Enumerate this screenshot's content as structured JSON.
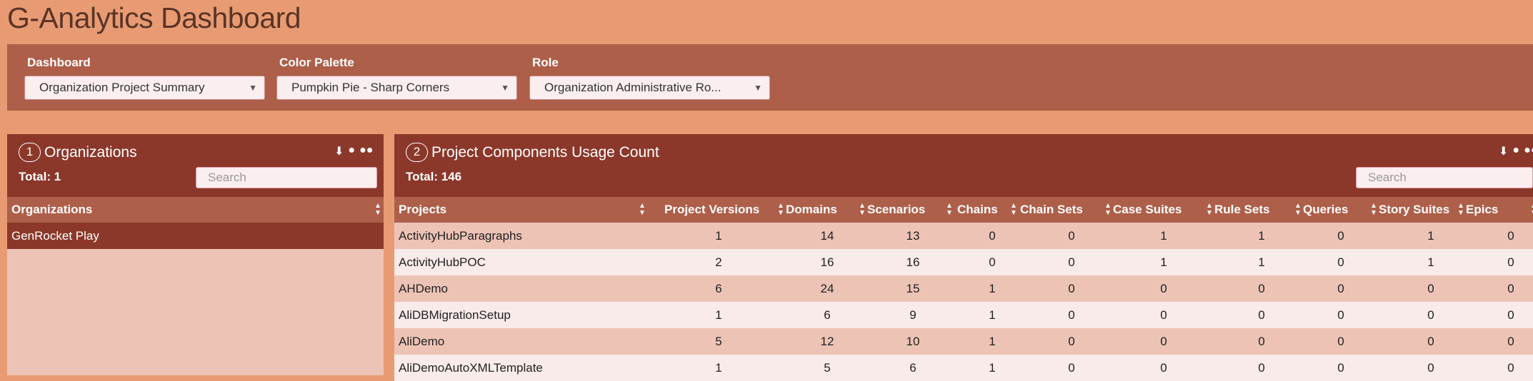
{
  "page": {
    "title": "G-Analytics Dashboard"
  },
  "filters": {
    "dashboard": {
      "label": "Dashboard",
      "value": "Organization Project Summary"
    },
    "palette": {
      "label": "Color Palette",
      "value": "Pumpkin Pie - Sharp Corners"
    },
    "role": {
      "label": "Role",
      "value": "Organization Administrative Ro..."
    }
  },
  "orgs": {
    "number": "1",
    "title": "Organizations",
    "total": "Total: 1",
    "search_placeholder": "Search",
    "column": "Organizations",
    "rows": [
      "GenRocket Play"
    ]
  },
  "components": {
    "number": "2",
    "title": "Project Components Usage Count",
    "total": "Total: 146",
    "search_placeholder": "Search",
    "columns": [
      "Projects",
      "Project Versions",
      "Domains",
      "Scenarios",
      "Chains",
      "Chain Sets",
      "Case Suites",
      "Rule Sets",
      "Queries",
      "Story Suites",
      "Epics"
    ],
    "rows": [
      [
        "ActivityHubParagraphs",
        "1",
        "14",
        "13",
        "0",
        "0",
        "1",
        "1",
        "0",
        "1",
        "0"
      ],
      [
        "ActivityHubPOC",
        "2",
        "16",
        "16",
        "0",
        "0",
        "1",
        "1",
        "0",
        "1",
        "0"
      ],
      [
        "AHDemo",
        "6",
        "24",
        "15",
        "1",
        "0",
        "0",
        "0",
        "0",
        "0",
        "0"
      ],
      [
        "AliDBMigrationSetup",
        "1",
        "6",
        "9",
        "1",
        "0",
        "0",
        "0",
        "0",
        "0",
        "0"
      ],
      [
        "AliDemo",
        "5",
        "12",
        "10",
        "1",
        "0",
        "0",
        "0",
        "0",
        "0",
        "0"
      ],
      [
        "AliDemoAutoXMLTemplate",
        "1",
        "5",
        "6",
        "1",
        "0",
        "0",
        "0",
        "0",
        "0",
        "0"
      ]
    ]
  },
  "colors": {
    "background": "#e89b72",
    "panel_header": "#8b382a",
    "column_header": "#ae5f49",
    "row_a": "#edc3b6",
    "row_b": "#f9ebea",
    "selected_row": "#8b382a"
  },
  "icons": [
    "download-icon",
    "user-icon",
    "users-icon",
    "sort-icon",
    "chevron-down-icon"
  ]
}
